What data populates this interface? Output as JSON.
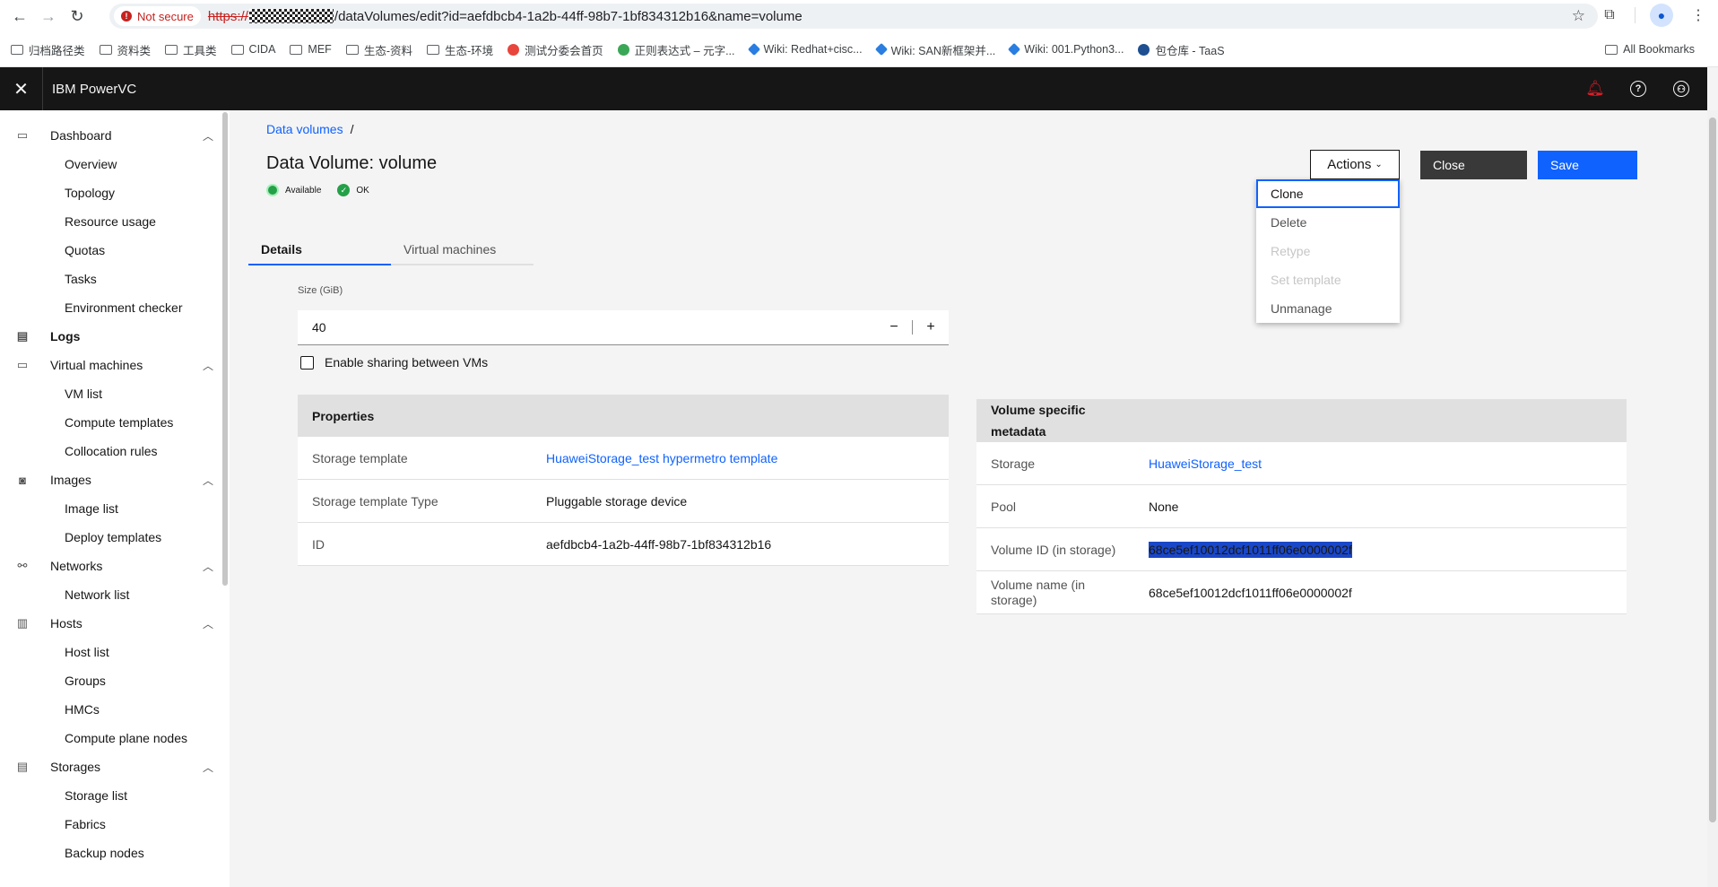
{
  "browser": {
    "not_secure": "Not secure",
    "url_scheme": "https://",
    "url_rest": "/dataVolumes/edit?id=aefdbcb4-1a2b-44ff-98b7-1bf834312b16&name=volume",
    "bookmarks": [
      "归档路径类",
      "资料类",
      "工具类",
      "CIDA",
      "MEF",
      "生态-资料",
      "生态-环境",
      "测试分委会首页",
      "正则表达式 – 元字...",
      "Wiki: Redhat+cisc...",
      "Wiki: SAN新框架并...",
      "Wiki: 001.Python3...",
      "包仓库 - TaaS"
    ],
    "all_bookmarks": "All Bookmarks"
  },
  "header": {
    "brand": "IBM PowerVC"
  },
  "sidebar": {
    "dashboard": "Dashboard",
    "overview": "Overview",
    "topology": "Topology",
    "resource_usage": "Resource usage",
    "quotas": "Quotas",
    "tasks": "Tasks",
    "env_checker": "Environment checker",
    "logs": "Logs",
    "virtual_machines": "Virtual machines",
    "vm_list": "VM list",
    "compute_templates": "Compute templates",
    "collocation_rules": "Collocation rules",
    "images": "Images",
    "image_list": "Image list",
    "deploy_templates": "Deploy templates",
    "networks": "Networks",
    "network_list": "Network list",
    "hosts": "Hosts",
    "host_list": "Host list",
    "groups": "Groups",
    "hmcs": "HMCs",
    "compute_plane_nodes": "Compute plane nodes",
    "storages": "Storages",
    "storage_list": "Storage list",
    "fabrics": "Fabrics",
    "backup_nodes": "Backup nodes"
  },
  "main": {
    "breadcrumb": "Data volumes",
    "breadcrumb_sep": "/",
    "title": "Data Volume: volume",
    "status_available": "Available",
    "status_ok": "OK",
    "actions": "Actions",
    "close": "Close",
    "save": "Save",
    "menu": {
      "clone": "Clone",
      "delete": "Delete",
      "retype": "Retype",
      "set_template": "Set template",
      "unmanage": "Unmanage"
    },
    "tabs": {
      "details": "Details",
      "virtual_machines": "Virtual machines"
    },
    "size_label": "Size (GiB)",
    "size_value": "40",
    "minus": "−",
    "plus": "+",
    "sharing_label": "Enable sharing between VMs",
    "properties": {
      "header": "Properties",
      "rows": [
        {
          "key": "Storage template",
          "value": "HuaweiStorage_test hypermetro template"
        },
        {
          "key": "Storage template Type",
          "value": "Pluggable storage device"
        },
        {
          "key": "ID",
          "value": "aefdbcb4-1a2b-44ff-98b7-1bf834312b16"
        }
      ]
    },
    "metadata": {
      "header_line1": "Volume specific",
      "header_line2": "metadata",
      "rows": [
        {
          "key": "Storage",
          "value": "HuaweiStorage_test"
        },
        {
          "key": "Pool",
          "value": "None"
        },
        {
          "key": "Volume ID (in storage)",
          "value": "68ce5ef10012dcf1011ff06e0000002f"
        },
        {
          "key_line1": "Volume name (in",
          "key_line2": "storage)",
          "value": "68ce5ef10012dcf1011ff06e0000002f"
        }
      ]
    }
  },
  "colors": {
    "primary": "#0f62fe",
    "header_bg": "#161616",
    "success": "#24a148",
    "alert": "#da1e28"
  }
}
